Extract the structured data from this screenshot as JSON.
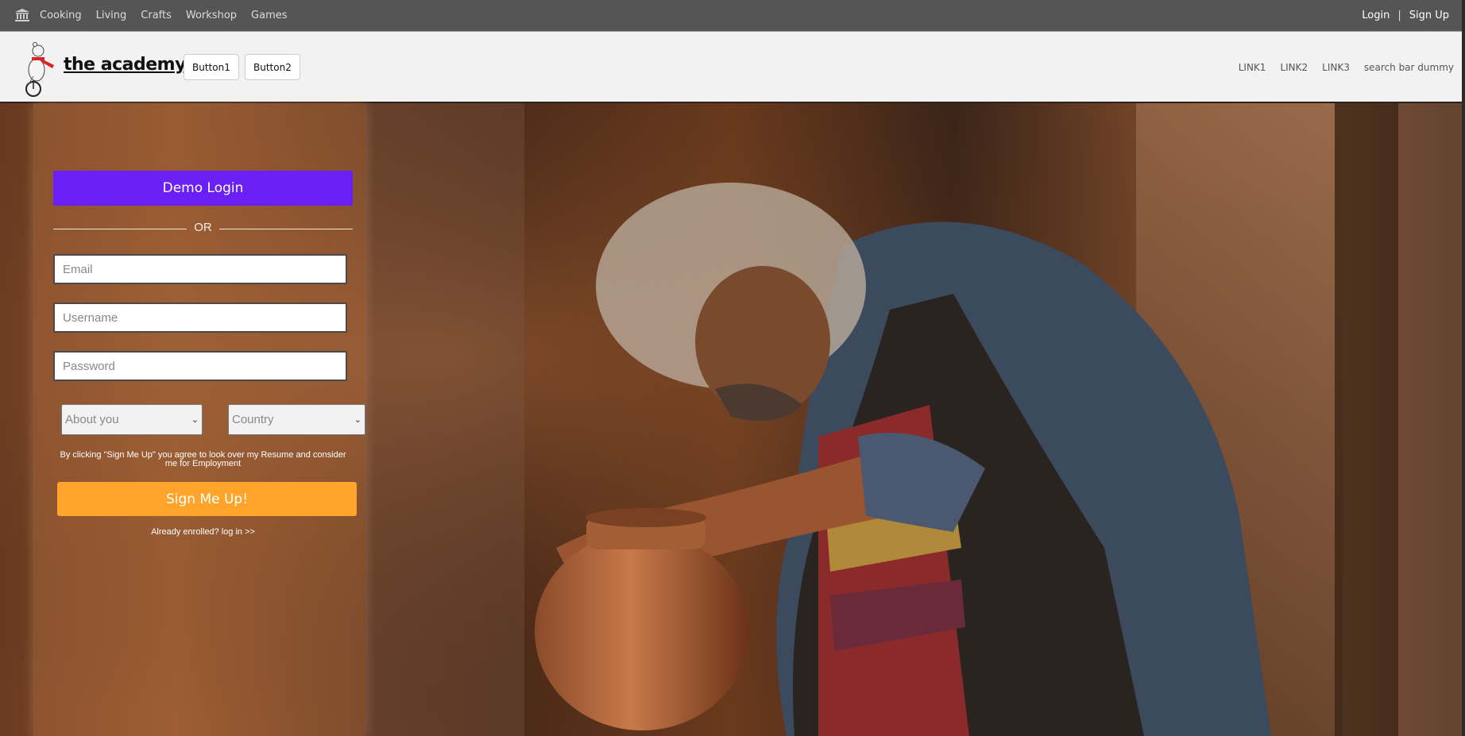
{
  "topbar": {
    "home_icon": "museum-icon",
    "nav": [
      "Cooking",
      "Living",
      "Crafts",
      "Workshop",
      "Games"
    ],
    "login": "Login",
    "separator": "|",
    "signup": "Sign Up"
  },
  "header": {
    "logo_icon": "unicycle-bear-logo",
    "brand": "the academy",
    "button1": "Button1",
    "button2": "Button2",
    "links": [
      "LINK1",
      "LINK2",
      "LINK3"
    ],
    "search": "search bar dummy"
  },
  "form": {
    "demo_login": "Demo Login",
    "or": "OR",
    "email_placeholder": "Email",
    "username_placeholder": "Username",
    "password_placeholder": "Password",
    "about_select": "About you",
    "country_select": "Country",
    "terms": "By clicking \"Sign Me Up\" you agree to look over my Resume and consider me for Employment",
    "signup_button": "Sign Me Up!",
    "already": "Already enrolled? log in >>"
  },
  "colors": {
    "topbar": "#555555",
    "demo_button": "#6a1ff5",
    "signup_button": "#ffa42b"
  }
}
